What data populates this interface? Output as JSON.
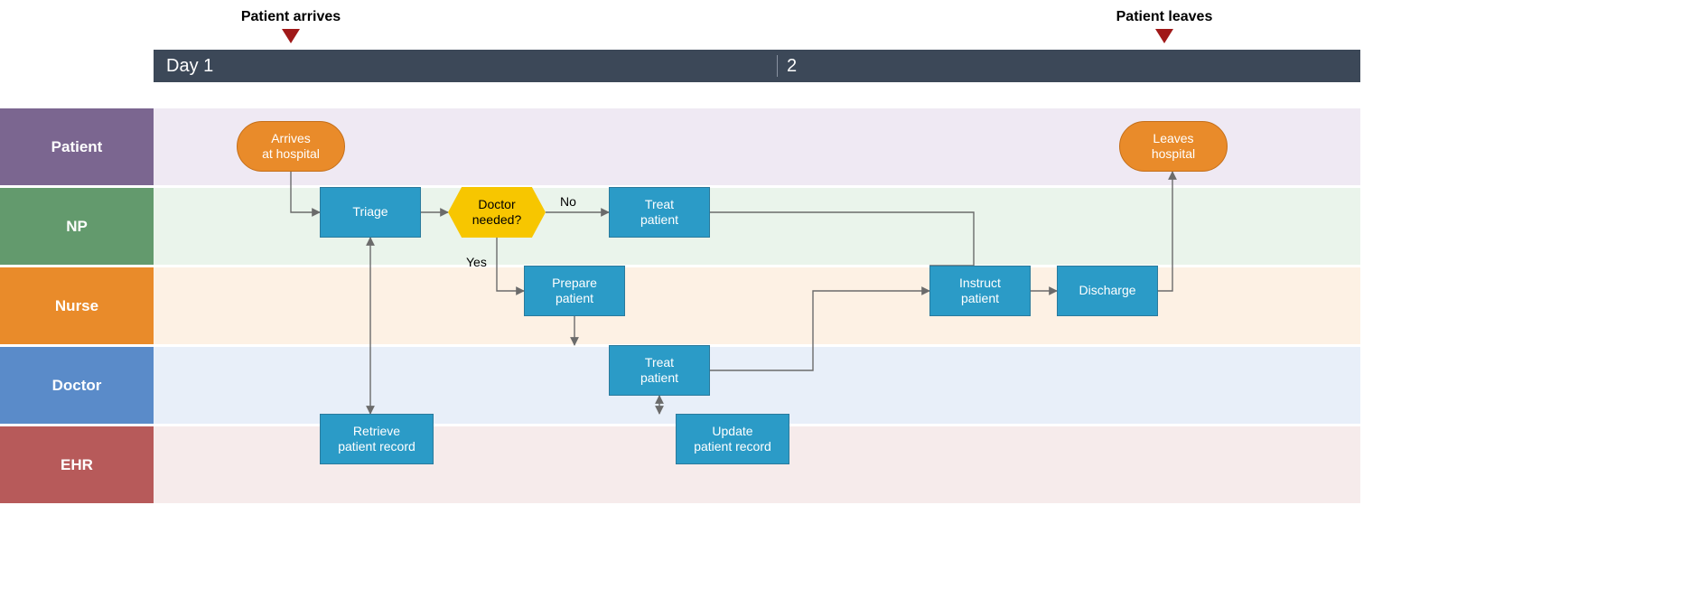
{
  "milestones": {
    "arrives": "Patient arrives",
    "leaves": "Patient leaves"
  },
  "timeline": {
    "day1": "Day 1",
    "day2": "2"
  },
  "lanes": {
    "patient": "Patient",
    "np": "NP",
    "nurse": "Nurse",
    "doctor": "Doctor",
    "ehr": "EHR"
  },
  "nodes": {
    "arrives": "Arrives\nat hospital",
    "triage": "Triage",
    "decision": "Doctor\nneeded?",
    "treat_np": "Treat\npatient",
    "prepare": "Prepare\npatient",
    "treat_doc": "Treat\npatient",
    "retrieve": "Retrieve\npatient record",
    "update": "Update\npatient record",
    "instruct": "Instruct\npatient",
    "discharge": "Discharge",
    "leaves": "Leaves\nhospital"
  },
  "edges": {
    "no": "No",
    "yes": "Yes"
  },
  "diagram": {
    "type": "swimlane-flowchart",
    "lanes": [
      "Patient",
      "NP",
      "Nurse",
      "Doctor",
      "EHR"
    ],
    "flow": [
      {
        "id": "arrives",
        "lane": "Patient",
        "kind": "terminator"
      },
      {
        "id": "triage",
        "lane": "NP",
        "kind": "process"
      },
      {
        "id": "retrieve",
        "lane": "EHR",
        "kind": "process"
      },
      {
        "id": "decision",
        "lane": "NP",
        "kind": "decision",
        "question": "Doctor needed?"
      },
      {
        "id": "treat_np",
        "lane": "NP",
        "kind": "process"
      },
      {
        "id": "prepare",
        "lane": "Nurse",
        "kind": "process"
      },
      {
        "id": "treat_doc",
        "lane": "Doctor",
        "kind": "process"
      },
      {
        "id": "update",
        "lane": "EHR",
        "kind": "process"
      },
      {
        "id": "instruct",
        "lane": "Nurse",
        "kind": "process"
      },
      {
        "id": "discharge",
        "lane": "Nurse",
        "kind": "process"
      },
      {
        "id": "leaves",
        "lane": "Patient",
        "kind": "terminator"
      }
    ],
    "connections": [
      {
        "from": "arrives",
        "to": "triage"
      },
      {
        "from": "triage",
        "to": "retrieve",
        "bidirectional": true
      },
      {
        "from": "triage",
        "to": "decision"
      },
      {
        "from": "decision",
        "to": "treat_np",
        "label": "No"
      },
      {
        "from": "decision",
        "to": "prepare",
        "label": "Yes"
      },
      {
        "from": "prepare",
        "to": "treat_doc"
      },
      {
        "from": "treat_doc",
        "to": "update",
        "bidirectional": true
      },
      {
        "from": "treat_np",
        "to": "instruct"
      },
      {
        "from": "treat_doc",
        "to": "instruct"
      },
      {
        "from": "instruct",
        "to": "discharge"
      },
      {
        "from": "discharge",
        "to": "leaves"
      }
    ],
    "milestones": [
      {
        "label": "Patient arrives",
        "at": "arrives"
      },
      {
        "label": "Patient leaves",
        "at": "leaves"
      }
    ]
  }
}
